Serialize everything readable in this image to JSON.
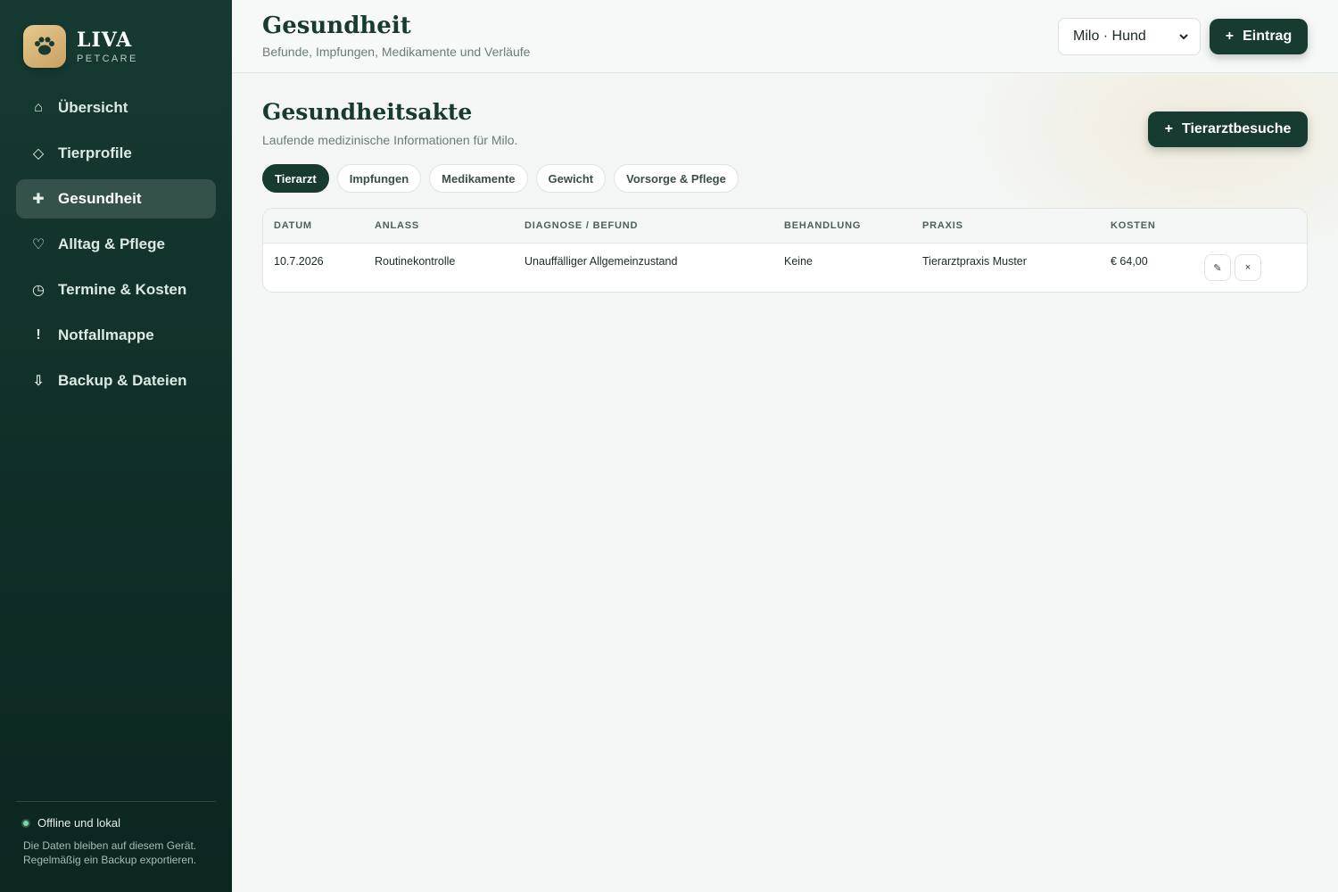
{
  "brand": {
    "name": "LIVA",
    "subtitle": "PETCARE"
  },
  "sidebar": {
    "items": [
      {
        "label": "Übersicht",
        "icon": "home-icon"
      },
      {
        "label": "Tierprofile",
        "icon": "diamond-icon"
      },
      {
        "label": "Gesundheit",
        "icon": "cross-icon",
        "active": true
      },
      {
        "label": "Alltag & Pflege",
        "icon": "heart-icon"
      },
      {
        "label": "Termine & Kosten",
        "icon": "clock-icon"
      },
      {
        "label": "Notfallmappe",
        "icon": "exclamation-icon"
      },
      {
        "label": "Backup & Dateien",
        "icon": "download-icon"
      }
    ],
    "status": {
      "label": "Offline und lokal",
      "note": "Die Daten bleiben auf diesem Gerät. Regelmäßig ein Backup exportieren."
    }
  },
  "header": {
    "title": "Gesundheit",
    "subtitle": "Befunde, Impfungen, Medikamente und Verläufe",
    "pet_select": "Milo · Hund",
    "entry_button": "Eintrag"
  },
  "main": {
    "title": "Gesundheitsakte",
    "subtitle": "Laufende medizinische Informationen für Milo.",
    "vet_button": "Tierarztbesuche",
    "tabs": [
      {
        "label": "Tierarzt",
        "active": true
      },
      {
        "label": "Impfungen"
      },
      {
        "label": "Medikamente"
      },
      {
        "label": "Gewicht"
      },
      {
        "label": "Vorsorge & Pflege"
      }
    ],
    "table": {
      "headers": [
        "DATUM",
        "ANLASS",
        "DIAGNOSE / BEFUND",
        "BEHANDLUNG",
        "PRAXIS",
        "KOSTEN"
      ],
      "rows": [
        [
          "10.7.2026",
          "Routinekontrolle",
          "Unauffälliger Allgemeinzustand",
          "Keine",
          "Tierarztpraxis Muster",
          "€ 64,00"
        ]
      ],
      "row_actions": {
        "edit": "✎",
        "delete": "×"
      }
    }
  },
  "colors": {
    "sidebar": "#163a32",
    "accent": "#173a31",
    "brand_gold": "#d9b77a",
    "status_online": "#7fd6a2"
  }
}
